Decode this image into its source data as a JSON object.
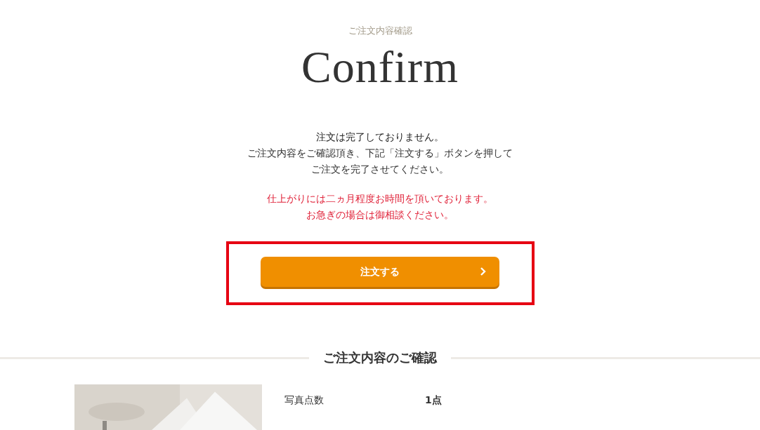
{
  "header": {
    "subtitle": "ご注文内容確認",
    "title": "Confirm"
  },
  "notice": {
    "lines": [
      "注文は完了しておりません。",
      "ご注文内容をご確認頂き、下記「注文する」ボタンを押して",
      "ご注文を完了させてください。"
    ],
    "warning_lines": [
      "仕上がりには二ヵ月程度お時間を頂いております。",
      "お急ぎの場合は御相談ください。"
    ]
  },
  "order_button": {
    "label": "注文する",
    "highlighted": true
  },
  "summary": {
    "heading": "ご注文内容のご確認",
    "rows": [
      {
        "label": "写真点数",
        "value": "1点"
      }
    ]
  }
}
